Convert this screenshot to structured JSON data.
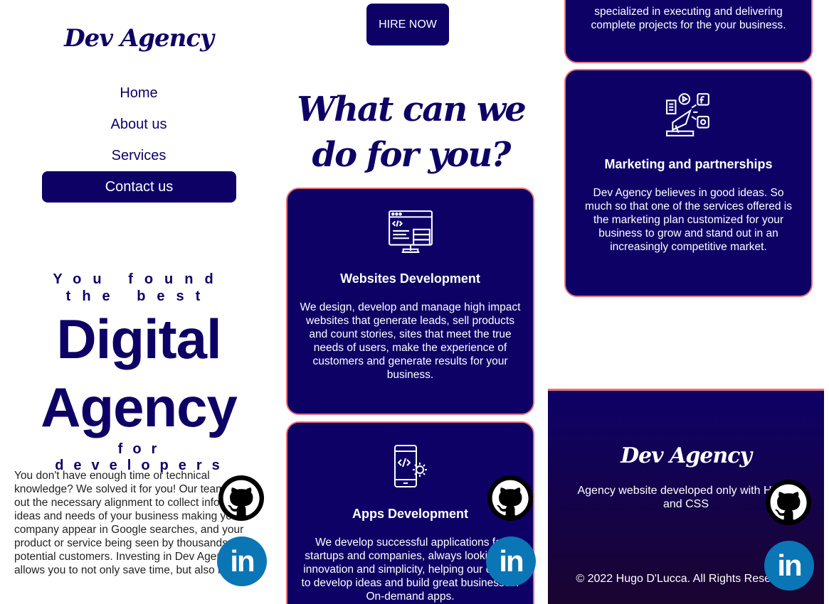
{
  "brand": {
    "logo": "Dev Agency"
  },
  "nav": {
    "items": [
      "Home",
      "About us",
      "Services"
    ],
    "contact": "Contact us"
  },
  "hero": {
    "tagline_top": "You found the best",
    "title_line1": "Digital",
    "title_line2": "Agency",
    "tagline_bottom": "for developers",
    "intro": "You don't have enough time or technical knowledge? We solved it for you! Our team carry out the necessary alignment to collect information, ideas and needs of your business making your company appear in Google searches, and your product or service being seen by thousands of potential customers. Investing in Dev Agency allows you to not only save time, but also money."
  },
  "hire": {
    "label": "HIRE NOW"
  },
  "services": {
    "heading": "What can we do for you?",
    "top_card_text": "specialized in executing and delivering complete projects for the your business.",
    "cards": [
      {
        "title": "Websites Development",
        "text": "We design, develop and manage high impact websites that generate leads, sell products and count stories, sites that meet the true needs of users, make the experience of customers and generate results for your business.",
        "icon": "web-development-icon"
      },
      {
        "title": "Apps Development",
        "text": "We develop successful applications for startups and companies, always looking for innovation and simplicity, helping our clients to develop ideas and build great businesses. On-demand apps.",
        "icon": "mobile-app-icon"
      },
      {
        "title": "Marketing and partnerships",
        "text": "Dev Agency believes in good ideas. So much so that one of the services offered is the marketing plan customized for your business to grow and stand out in an increasingly competitive market.",
        "icon": "marketing-icon"
      }
    ]
  },
  "footer": {
    "logo": "Dev Agency",
    "description": "Agency website developed only with HTML and CSS",
    "copyright": "© 2022 Hugo D'Lucca. All Rights Reserved."
  },
  "social": {
    "linkedin_label": "in",
    "github_icon": "github-icon",
    "linkedin_icon": "linkedin-icon"
  },
  "colors": {
    "navy": "#0e0166",
    "accent_border": "#e8707a",
    "linkedin_blue": "#0a76b6"
  }
}
